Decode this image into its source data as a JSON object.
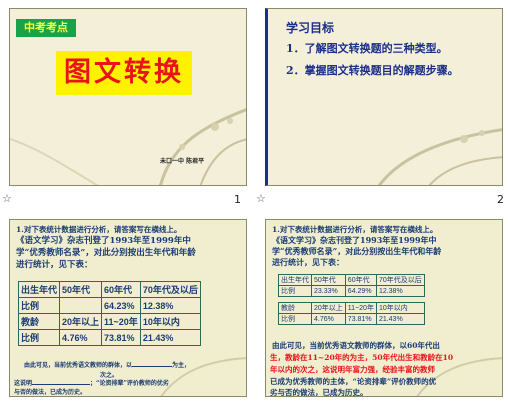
{
  "slides": [
    {
      "number": "1",
      "tag": "中考考点",
      "title": "图文转换",
      "author": "未口一中    陈君平"
    },
    {
      "number": "2",
      "heading": "学习目标",
      "items": [
        "1．了解图文转换题的三种类型。",
        "2．掌握图文转换题目的解题步骤。"
      ]
    },
    {
      "lines": [
        "1.对下表统计数据进行分析，请答案写在横线上。",
        "  《语文学习》杂志刊登了1993年至1999年中",
        "学“优秀教师名录”，对此分别按出生年代和年龄",
        "进行统计，见下表："
      ],
      "table": [
        [
          "出生年代",
          "50年代",
          "60年代",
          "70年代及以后"
        ],
        [
          "比例",
          "",
          "64.23%",
          "12.38%"
        ],
        [
          "教龄",
          "20年以上",
          "11~20年",
          "10年以内"
        ],
        [
          "比例",
          "4.76%",
          "73.81%",
          "21.43%"
        ]
      ],
      "note1": "由此可见，当前优秀语文教师的群体，以",
      "note1b": "为主，",
      "note1c": "次之。",
      "note2a": "这说明",
      "note2b": "；“论资排辈”评价教师的优劣",
      "note3": "与否的做法，已成为历史。"
    },
    {
      "lines": [
        "1.对下表统计数据进行分析，请答案写在横线上。",
        "  《语文学习》杂志刊登了1993年至1999年中",
        "学“优秀教师名录”，对此分别按出生年代和年龄",
        "进行统计，见下表："
      ],
      "table": [
        [
          "出生年代",
          "50年代",
          "60年代",
          "70年代及以后"
        ],
        [
          "比例",
          "23.33%",
          "64.29%",
          "12.38%"
        ],
        [
          "教龄",
          "20年以上",
          "11~20年",
          "10年以内"
        ],
        [
          "比例",
          "4.76%",
          "73.81%",
          "21.43%"
        ]
      ],
      "conclusion": [
        "由此可见，当前优秀语文教师的群体，以60年代出",
        "生，教龄在11~20年的为主，50年代出生和教龄在10",
        "年以内的次之，这说明年富力强，经验丰富的教师",
        "已成为优秀教师的主体，“论资排辈”评价教师的优",
        "劣与否的做法，已成为历史。"
      ]
    }
  ],
  "colors": {
    "accent": "#1c2f8a",
    "highlight": "#fff200",
    "red": "#e8141a",
    "tag_bg": "#17a34a"
  }
}
